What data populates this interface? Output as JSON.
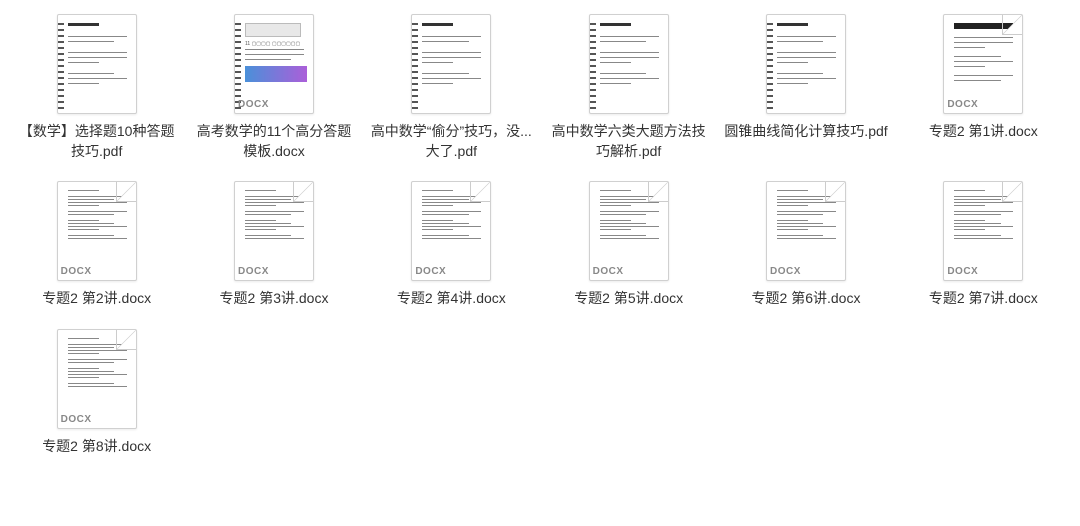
{
  "files": [
    {
      "name": "【数学】选择题10种答题技巧.pdf",
      "type": "pdf",
      "style": "spiral"
    },
    {
      "name": "高考数学的11个高分答题模板.docx",
      "type": "docx",
      "style": "spiral-color"
    },
    {
      "name": "高中数学“偷分”技巧，没...大了.pdf",
      "type": "pdf",
      "style": "spiral"
    },
    {
      "name": "高中数学六类大题方法技巧解析.pdf",
      "type": "pdf",
      "style": "spiral"
    },
    {
      "name": "圆锥曲线简化计算技巧.pdf",
      "type": "pdf",
      "style": "spiral"
    },
    {
      "name": "专题2 第1讲.docx",
      "type": "docx",
      "style": "header"
    },
    {
      "name": "专题2 第2讲.docx",
      "type": "docx",
      "style": "plain"
    },
    {
      "name": "专题2 第3讲.docx",
      "type": "docx",
      "style": "plain"
    },
    {
      "name": "专题2 第4讲.docx",
      "type": "docx",
      "style": "plain"
    },
    {
      "name": "专题2 第5讲.docx",
      "type": "docx",
      "style": "plain"
    },
    {
      "name": "专题2 第6讲.docx",
      "type": "docx",
      "style": "plain"
    },
    {
      "name": "专题2 第7讲.docx",
      "type": "docx",
      "style": "plain"
    },
    {
      "name": "专题2 第8讲.docx",
      "type": "docx",
      "style": "plain"
    }
  ],
  "badge_docx": "DOCX"
}
